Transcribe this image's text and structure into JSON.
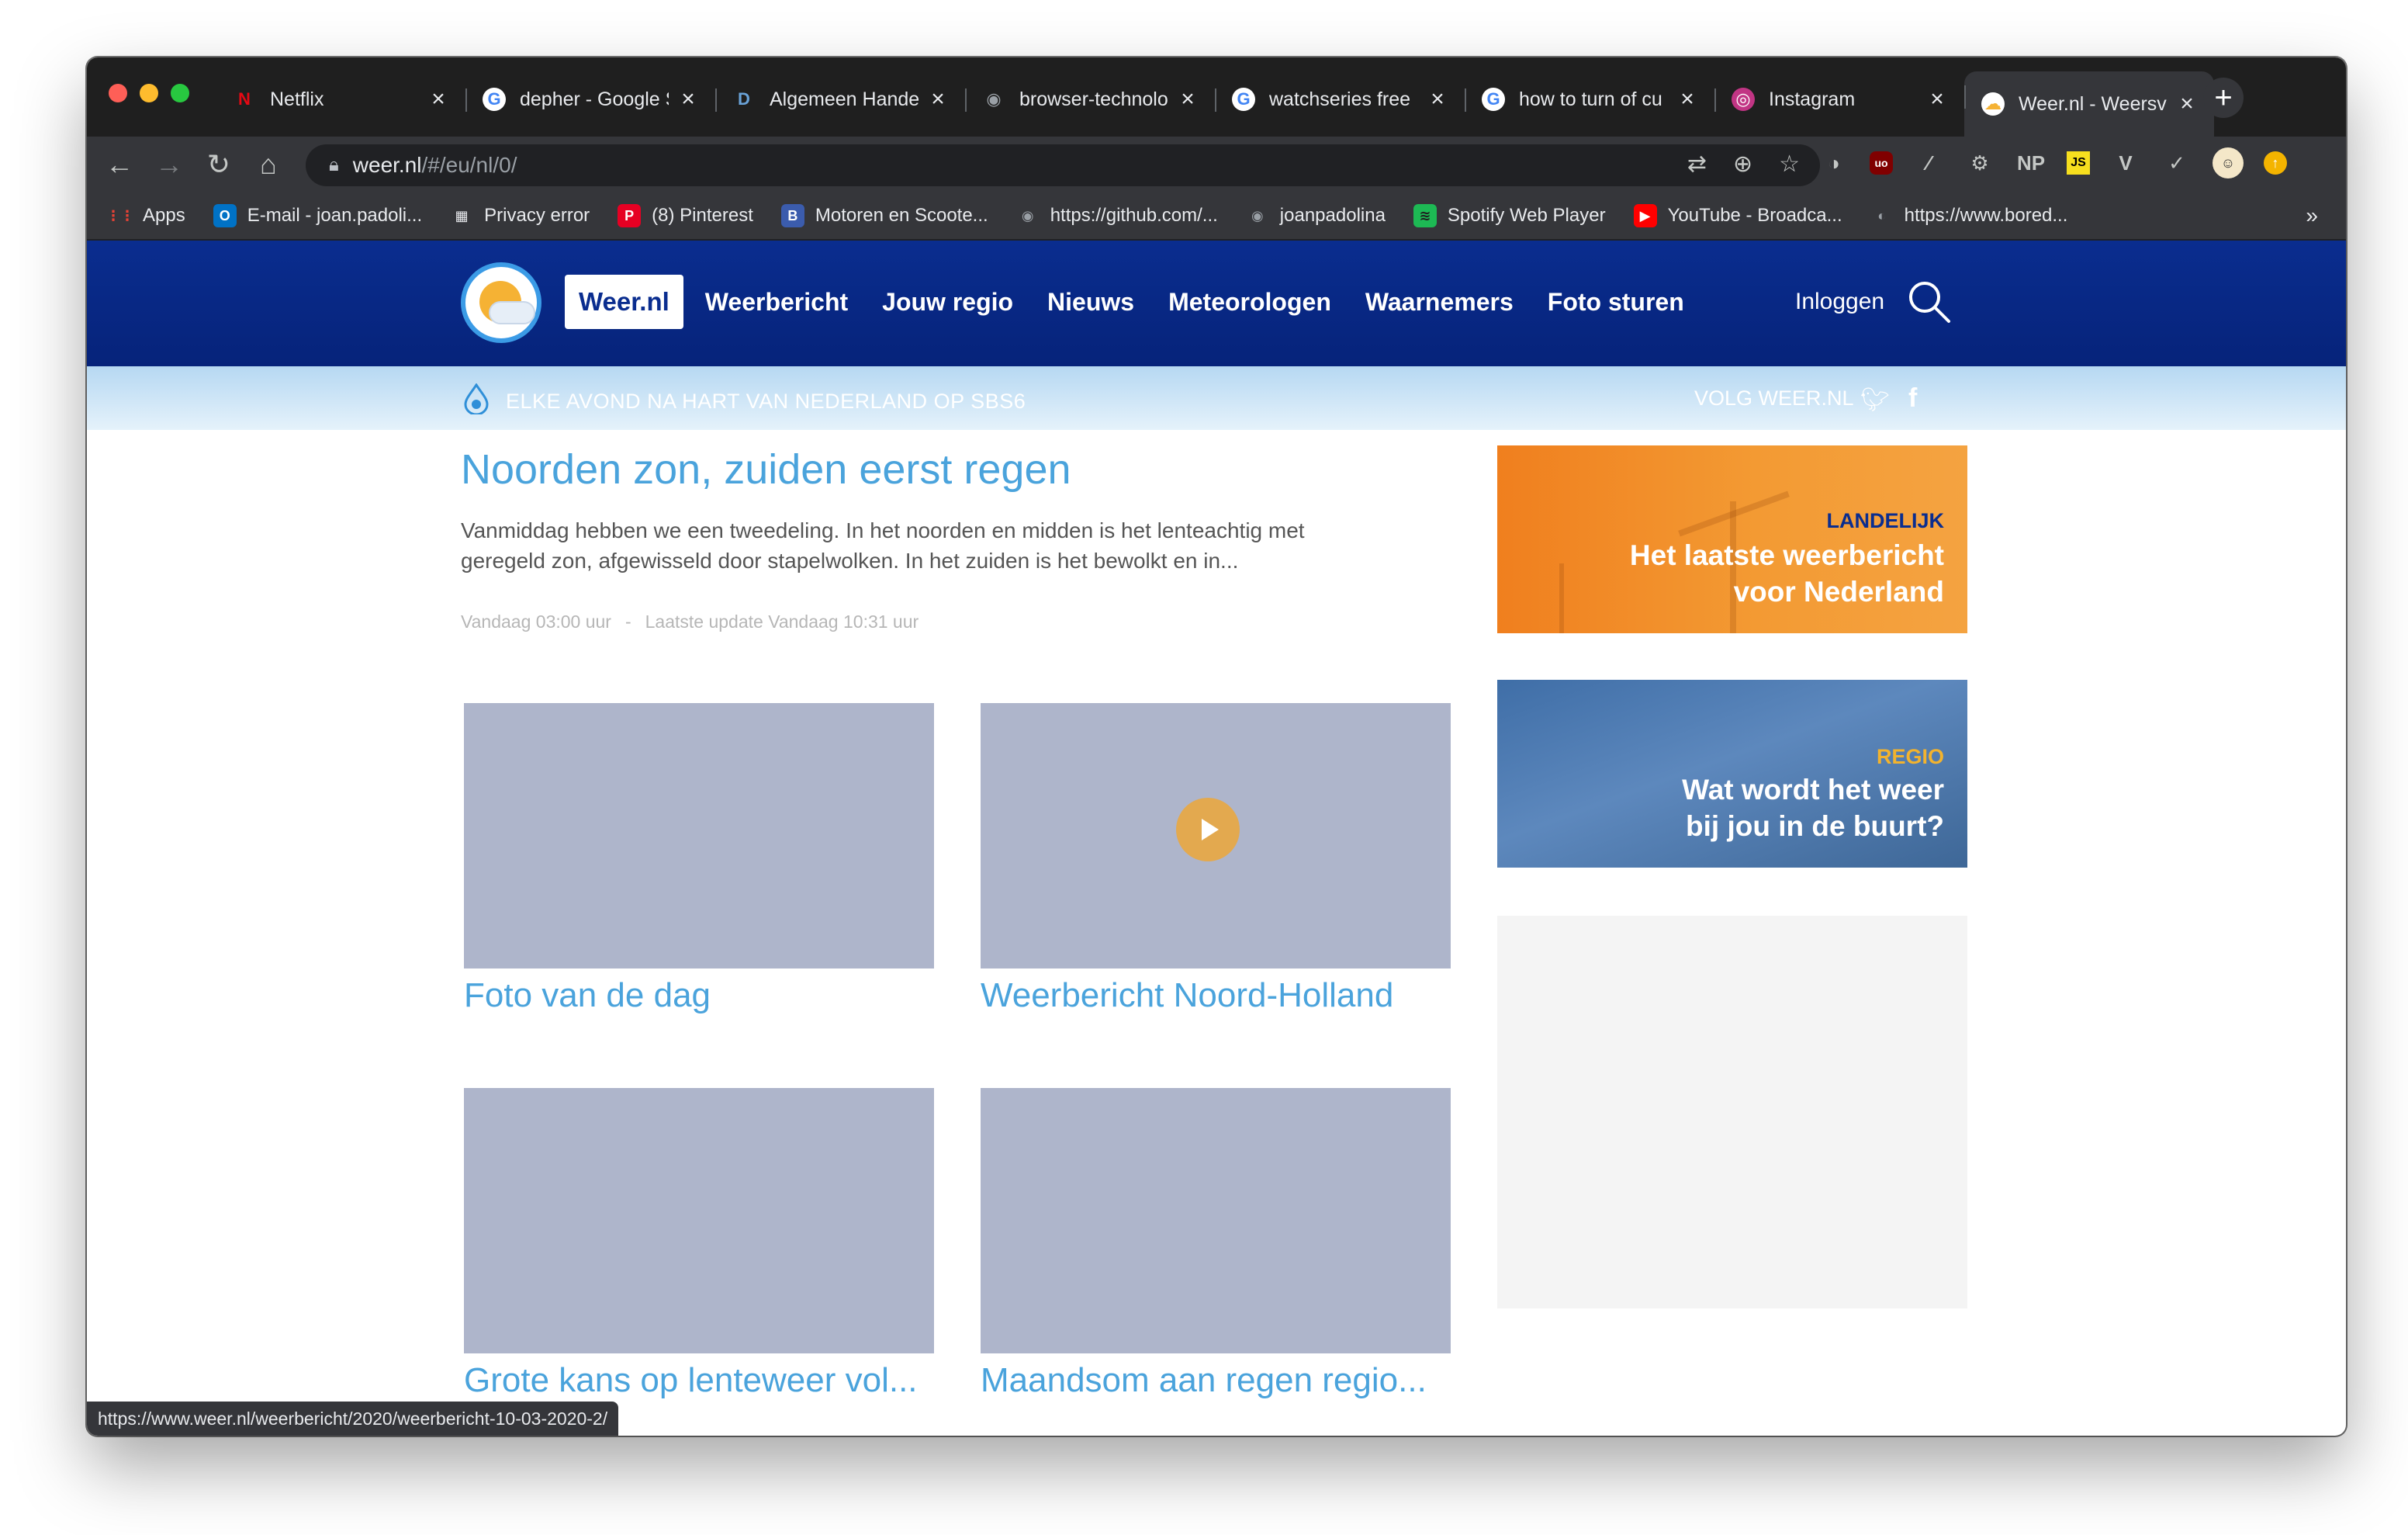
{
  "browser": {
    "tabs": [
      {
        "title": "Netflix",
        "icon": "netflix-icon",
        "glyph": "N",
        "color": "#e50914",
        "bg": "transparent"
      },
      {
        "title": "depher - Google S",
        "icon": "google-icon",
        "glyph": "G",
        "color": "#4285f4",
        "bg": "#ffffff"
      },
      {
        "title": "Algemeen Handel",
        "icon": "d-icon",
        "glyph": "D",
        "color": "#6aa3d8",
        "bg": "transparent"
      },
      {
        "title": "browser-technolo",
        "icon": "github-icon",
        "glyph": "◉",
        "color": "#9aa0a6",
        "bg": "transparent"
      },
      {
        "title": "watchseries free",
        "icon": "google-icon",
        "glyph": "G",
        "color": "#4285f4",
        "bg": "#ffffff"
      },
      {
        "title": "how to turn of cu",
        "icon": "google-icon",
        "glyph": "G",
        "color": "#4285f4",
        "bg": "#ffffff"
      },
      {
        "title": "Instagram",
        "icon": "instagram-icon",
        "glyph": "◎",
        "color": "#ffffff",
        "bg": "#c13584"
      },
      {
        "title": "Weer.nl - Weersv",
        "icon": "weer-icon",
        "glyph": "☁",
        "color": "#f5b234",
        "bg": "#ffffff"
      }
    ],
    "active_tab": 7,
    "url_host": "weer.nl",
    "url_path": "/#/eu/nl/0/",
    "bookmarks": [
      {
        "label": "Apps",
        "icon": "apps-grid-icon",
        "glyph": "⋮⋮",
        "color": "#e94235",
        "bg": "transparent"
      },
      {
        "label": "E-mail - joan.padoli...",
        "icon": "outlook-icon",
        "glyph": "O",
        "color": "#ffffff",
        "bg": "#0072c6"
      },
      {
        "label": "Privacy error",
        "icon": "qr-icon",
        "glyph": "▦",
        "color": "#e8eaed",
        "bg": "transparent"
      },
      {
        "label": "(8) Pinterest",
        "icon": "pinterest-icon",
        "glyph": "P",
        "color": "#ffffff",
        "bg": "#e60023"
      },
      {
        "label": "Motoren en Scoote...",
        "icon": "bva-icon",
        "glyph": "B",
        "color": "#ffffff",
        "bg": "#3b5cad"
      },
      {
        "label": "https://github.com/...",
        "icon": "github-icon",
        "glyph": "◉",
        "color": "#9aa0a6",
        "bg": "transparent"
      },
      {
        "label": "joanpadolina",
        "icon": "github-icon",
        "glyph": "◉",
        "color": "#9aa0a6",
        "bg": "transparent"
      },
      {
        "label": "Spotify Web Player",
        "icon": "spotify-icon",
        "glyph": "≋",
        "color": "#1f1f1f",
        "bg": "#1db954"
      },
      {
        "label": "YouTube - Broadca...",
        "icon": "youtube-icon",
        "glyph": "▶",
        "color": "#ffffff",
        "bg": "#ff0000"
      },
      {
        "label": "https://www.bored...",
        "icon": "bored-icon",
        "glyph": "◐",
        "color": "#9aa0a6",
        "bg": "transparent"
      }
    ],
    "more_glyph": "»",
    "status_url": "https://www.weer.nl/weerbericht/2020/weerbericht-10-03-2020-2/"
  },
  "site": {
    "home_label": "Weer.nl",
    "nav": [
      "Weerbericht",
      "Jouw regio",
      "Nieuws",
      "Meteorologen",
      "Waarnemers",
      "Foto sturen"
    ],
    "login": "Inloggen",
    "promo": "ELKE AVOND NA HART VAN NEDERLAND OP SBS6",
    "follow": "VOLG WEER.NL"
  },
  "article": {
    "headline": "Noorden zon, zuiden eerst regen",
    "lead": "Vanmiddag hebben we een tweedeling. In het noorden en midden is het lenteachtig met geregeld zon, afgewisseld door stapelwolken. In het zuiden is het bewolkt en in...",
    "published": "Vandaag 03:00 uur",
    "separator": "-",
    "updated": "Laatste update Vandaag 10:31 uur"
  },
  "cards": [
    {
      "title": "Foto van de dag"
    },
    {
      "title": "Weerbericht Noord-Holland"
    },
    {
      "title": "Grote kans op lenteweer vol..."
    },
    {
      "title": "Maandsom aan regen regio..."
    }
  ],
  "ads": {
    "orange": {
      "tag": "LANDELIJK",
      "line1": "Het laatste weerbericht",
      "line2": "voor Nederland"
    },
    "blue": {
      "tag": "REGIO",
      "line1": "Wat wordt het weer",
      "line2": "bij jou in de buurt?"
    }
  }
}
